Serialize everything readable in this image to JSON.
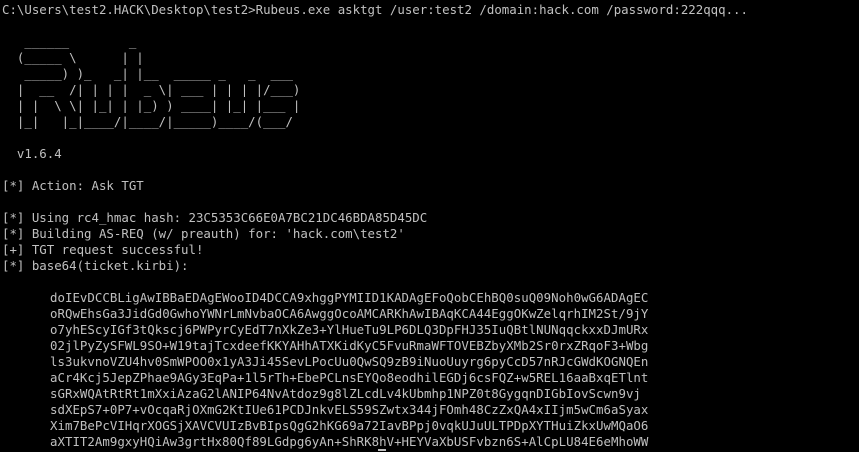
{
  "console": {
    "command_line": "C:\\Users\\test2.HACK\\Desktop\\test2>Rubeus.exe asktgt /user:test2 /domain:hack.com /password:222qqq...",
    "banner": [
      "   ______        _",
      "  (_____ \\      | |",
      "   _____) )_   _| |__  _____ _   _  ___",
      "  |  __  /| | | |  _ \\| ___ | | | |/___)",
      "  | |  \\ \\| |_| | |_) ) ____| |_| |___ |",
      "  |_|   |_|____/|____/|_____)____/(___/"
    ],
    "version": "  v1.6.4",
    "action": "[*] Action: Ask TGT",
    "hash_line": "[*] Using rc4_hmac hash: 23C5353C66E0A7BC21DC46BDA85D45DC",
    "building_line": "[*] Building AS-REQ (w/ preauth) for: 'hack.com\\test2'",
    "success_line": "[+] TGT request successful!",
    "base64_label": "[*] base64(ticket.kirbi):",
    "ticket_lines": [
      "doIEvDCCBLigAwIBBaEDAgEWooID4DCCA9xhggPYMIID1KADAgEFoQobCEhBQ0suQ09Noh0wG6ADAgEC",
      "oRQwEhsGa3JidGd0GwhoYWNrLmNvbaOCA6AwggOcoAMCARKhAwIBAqKCA44EggOKwZelqrhIM2St/9jY",
      "o7yhEScyIGf3tQkscj6PWPyrCyEdT7nXkZe3+YlHueTu9LP6DLQ3DpFHJ35IuQBtlNUNqqckxxDJmURx",
      "02jlPyZySFWL9SO+W19tajTcxdeefKKYAHhATXKidKyC5FvuRmaWFTOVEBZbyXMb2Sr0rxZRqoF3+Wbg",
      "ls3ukvnoVZU4hv0SmWPOO0x1yA3Ji45SevLPocUu0QwSQ9zB9iNuoUuyrg6pyCcD57nRJcGWdKOGNQEn",
      "aCr4Kcj5JepZPhae9AGy3EqPa+1l5rTh+EbePCLnsEYQo8eodhilEGDj6csFQZ+w5REL16aaBxqETlnt",
      "sGRxWQAtRtRt1mXxiAzaG2lANIP64NvAtdoz9g8lZLcdLv4kUbmhp1NPZ0t8GygqnDIGbIovScwn9vj",
      "sdXEpS7+0P7+vOcqaRjOXmG2KtIUe61PCDJnkvELS59SZwtx344jFOmh48CzZxQA4xIIjm5wCm6aSyax",
      "Xim7BePcVIHqrXOGSjXAVCVUIzBvBIpsQgG2hKG69a72IavBPpj0vqkUJuULTPDpXYTHuiZkxUwMQaO6",
      "aXTIT2Am9gxyHQiAw3grtHx80Qf89LGdpg6yAn+ShRK8hV+HEYVaXbUSFvbzn6S+AlCpLU84E6eMhoWW"
    ]
  }
}
